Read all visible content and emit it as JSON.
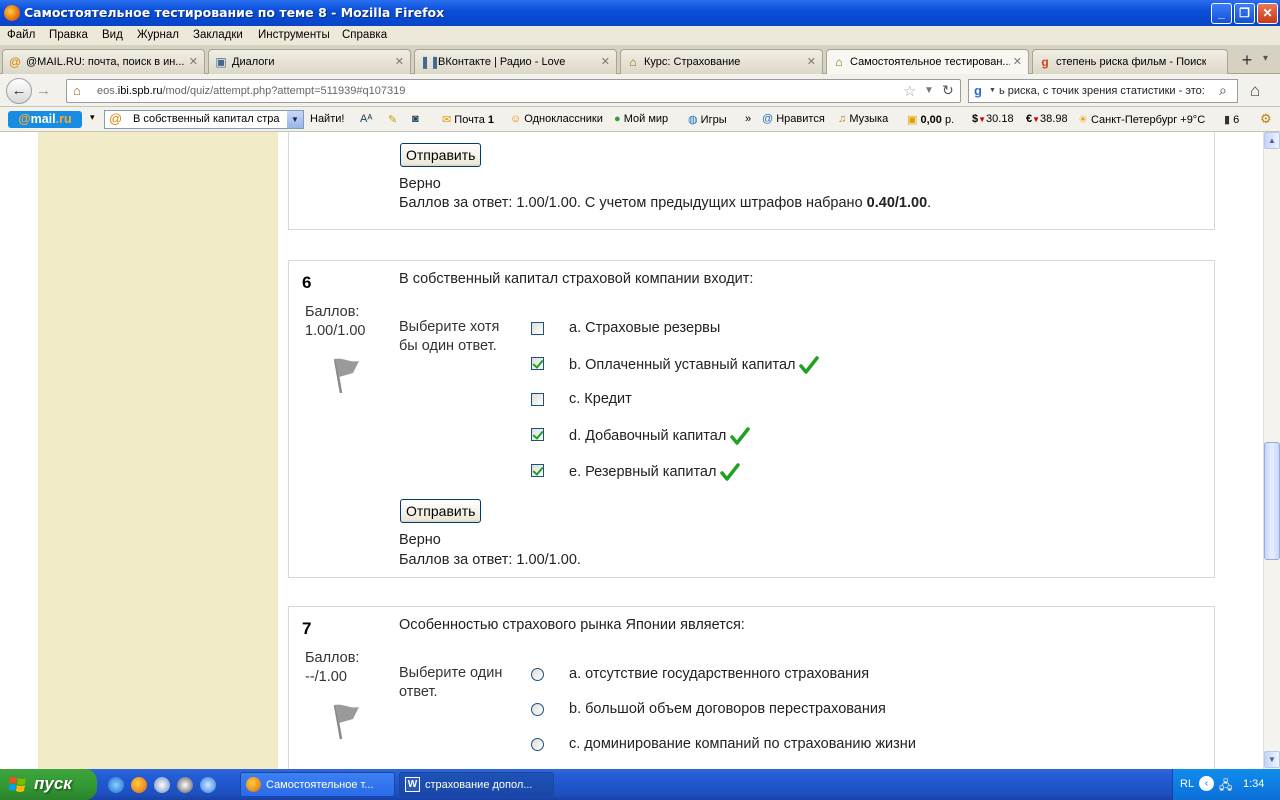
{
  "window": {
    "title": "Самостоятельное тестирование по теме 8 - Mozilla Firefox"
  },
  "menu": [
    "Файл",
    "Правка",
    "Вид",
    "Журнал",
    "Закладки",
    "Инструменты",
    "Справка"
  ],
  "tabs": [
    {
      "label": "@MAIL.RU: почта, поиск в ин...",
      "icon": "mailru-icon"
    },
    {
      "label": "Диалоги",
      "icon": "chat-icon"
    },
    {
      "label": "ВКонтакте | Радио - Love",
      "icon": "pause-icon"
    },
    {
      "label": "Курс: Страхование",
      "icon": "moodle-icon"
    },
    {
      "label": "Самостоятельное тестирован...",
      "icon": "moodle-icon"
    },
    {
      "label": "степень риска фильм - Поиск ...",
      "icon": "google-icon"
    }
  ],
  "nav": {
    "url_host": "eos.",
    "url_domain": "ibi.spb.ru",
    "url_path": "/mod/quiz/attempt.php?attempt=511939#q107319",
    "search_text": "ь риска, с точик зрения статистики - это:"
  },
  "mailbar": {
    "logo_a": "@",
    "logo_b": "mail",
    "logo_c": ".ru",
    "search_value": "В собственный капитал стра",
    "find_label": "Найти!",
    "items": {
      "pochta": "Почта",
      "pochta_count": "1",
      "odnoklassniki": "Одноклассники",
      "moimir": "Мой мир",
      "igry": "Игры",
      "more": "»",
      "nravitsya": "Нравится",
      "muzyka": "Музыка",
      "balance": "0,00",
      "balance_unit": "р.",
      "usd": "30.18",
      "eur": "38.98",
      "weather": "Санкт-Петербург +9°C",
      "traffic": "6"
    }
  },
  "q5": {
    "submit_label": "Отправить",
    "feedback_state": "Верно",
    "feedback_score_prefix": "Баллов за ответ: 1.00/1.00. С учетом предыдущих штрафов набрано ",
    "feedback_score_bold": "0.40/1.00",
    "feedback_score_suffix": "."
  },
  "q6": {
    "number": "6",
    "grade_label": "Баллов:",
    "grade_value": "1.00/1.00",
    "text": "В собственный капитал страховой компании входит:",
    "prompt": "Выберите хотя бы один ответ.",
    "options": [
      {
        "label": "a. Страховые резервы",
        "checked": false,
        "correct": false
      },
      {
        "label": "b. Оплаченный уставный капитал",
        "checked": true,
        "correct": true
      },
      {
        "label": "c. Кредит",
        "checked": false,
        "correct": false
      },
      {
        "label": "d. Добавочный капитал",
        "checked": true,
        "correct": true
      },
      {
        "label": "e. Резервный капитал",
        "checked": true,
        "correct": true
      }
    ],
    "submit_label": "Отправить",
    "feedback_state": "Верно",
    "feedback_score": "Баллов за ответ: 1.00/1.00."
  },
  "q7": {
    "number": "7",
    "grade_label": "Баллов:",
    "grade_value": "--/1.00",
    "text": "Особенностью страхового рынка Японии является:",
    "prompt": "Выберите один ответ.",
    "options": [
      {
        "label": "a. отсутствие государственного страхования"
      },
      {
        "label": "b. большой объем договоров перестрахования"
      },
      {
        "label": "c. доминирование компаний по страхованию жизни"
      }
    ]
  },
  "taskbar": {
    "start_label": "пуск",
    "buttons": [
      {
        "label": "Самостоятельное т...",
        "icon": "firefox-icon"
      },
      {
        "label": "страхование допол...",
        "icon": "word-icon"
      }
    ],
    "lang": "RL",
    "clock": "1:34"
  },
  "colors": {
    "accent": "#0a4fd8",
    "sidebar": "#f2ebc7",
    "check": "#21a121"
  }
}
